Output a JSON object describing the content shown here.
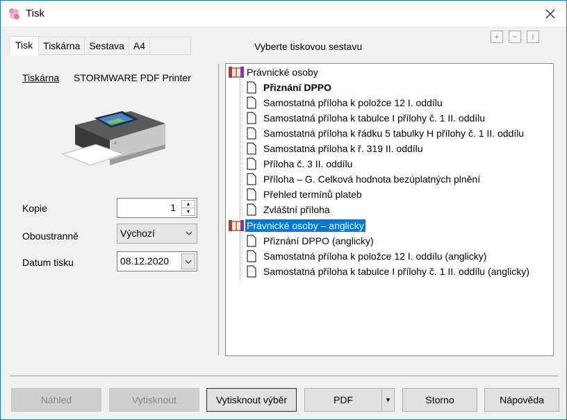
{
  "window": {
    "title": "Tisk"
  },
  "tabs": [
    "Tisk",
    "Tiskárna",
    "Sestava",
    "A4"
  ],
  "printer": {
    "link_label": "Tiskárna",
    "name": "STORMWARE PDF Printer"
  },
  "fields": {
    "copies_label": "Kopie",
    "copies_value": "1",
    "duplex_label": "Oboustranně",
    "duplex_value": "Výchozí",
    "date_label": "Datum tisku",
    "date_value": "08.12.2020"
  },
  "tree": {
    "heading": "Vyberte tiskovou sestavu",
    "groups": [
      {
        "label": "Právnické osoby",
        "items": [
          "Přiznání DPPO",
          "Samostatná příloha k položce 12 I. oddílu",
          "Samostatná příloha k tabulce I přílohy č. 1 II. oddílu",
          "Samostatná příloha k řádku 5 tabulky H přílohy č. 1 II. oddílu",
          "Samostatná příloha k ř. 319 II. oddílu",
          "Příloha č. 3 II. oddílu",
          "Příloha – G. Celková hodnota bezúplatných plnění",
          "Přehled termínů plateb",
          "Zvláštní příloha"
        ]
      },
      {
        "label": "Právnické osoby – anglicky",
        "items": [
          "Přiznání DPPO (anglicky)",
          "Samostatná příloha k položce 12 I. oddílu (anglicky)",
          "Samostatná příloha k tabulce I přílohy č. 1 II. oddílu (anglicky)"
        ]
      }
    ],
    "bold_item": "Přiznání DPPO",
    "selected_item": "Právnické osoby – anglicky"
  },
  "buttons": {
    "preview": "Náhled",
    "print": "Vytisknout",
    "print_selection": "Vytisknout výběr",
    "pdf": "PDF",
    "cancel": "Storno",
    "help": "Nápověda"
  },
  "colors": {
    "selection": "#0078d7",
    "window_border": "#1e73c9"
  }
}
